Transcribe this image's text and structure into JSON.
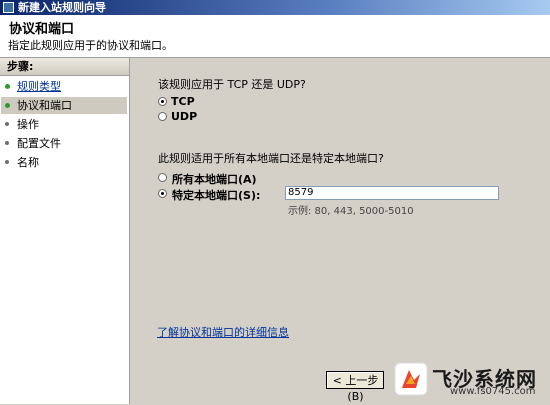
{
  "window": {
    "title": "新建入站规则向导"
  },
  "header": {
    "title": "协议和端口",
    "subtitle": "指定此规则应用于的协议和端口。"
  },
  "steps": {
    "heading": "步骤:",
    "items": [
      {
        "label": "规则类型"
      },
      {
        "label": "协议和端口"
      },
      {
        "label": "操作"
      },
      {
        "label": "配置文件"
      },
      {
        "label": "名称"
      }
    ]
  },
  "main": {
    "protocol_question": "该规则应用于 TCP 还是 UDP?",
    "protocol_options": [
      {
        "label": "TCP",
        "selected": true
      },
      {
        "label": "UDP",
        "selected": false
      }
    ],
    "port_question": "此规则适用于所有本地端口还是特定本地端口?",
    "port_options": [
      {
        "label": "所有本地端口(A)",
        "selected": false
      },
      {
        "label": "特定本地端口(S):",
        "selected": true
      }
    ],
    "port_value": "8579",
    "port_example": "示例: 80, 443, 5000-5010",
    "more_link": "了解协议和端口的详细信息"
  },
  "buttons": {
    "back": "< 上一步 (B)"
  },
  "watermark": {
    "text": "飞沙系统网",
    "url": "www.fs0745.com"
  }
}
